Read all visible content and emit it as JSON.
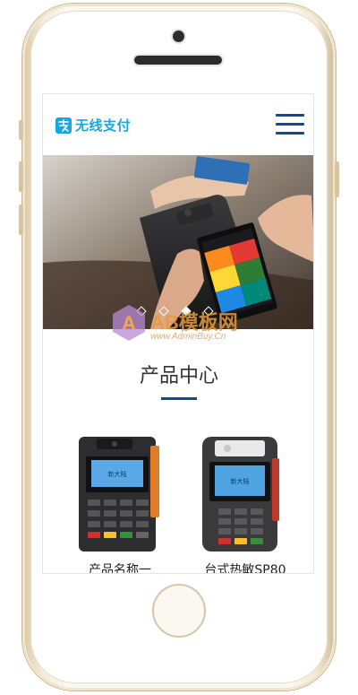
{
  "site": {
    "logo_text": "无线支付",
    "menu_icon": "hamburger-icon"
  },
  "banner": {
    "slides": 4,
    "active_slide": 3
  },
  "section": {
    "title": "产品中心"
  },
  "products": [
    {
      "name": "产品名称一",
      "screen_brand": "新大陆"
    },
    {
      "name": "台式热敏SP80",
      "screen_brand": "新大陆"
    }
  ],
  "watermark": {
    "text": "AB模板网",
    "sub": "www.AdminBuy.Cn"
  },
  "colors": {
    "brand_blue": "#1aa6de",
    "nav_blue": "#0f4b93",
    "phone_gold": "#d9c7a3"
  }
}
